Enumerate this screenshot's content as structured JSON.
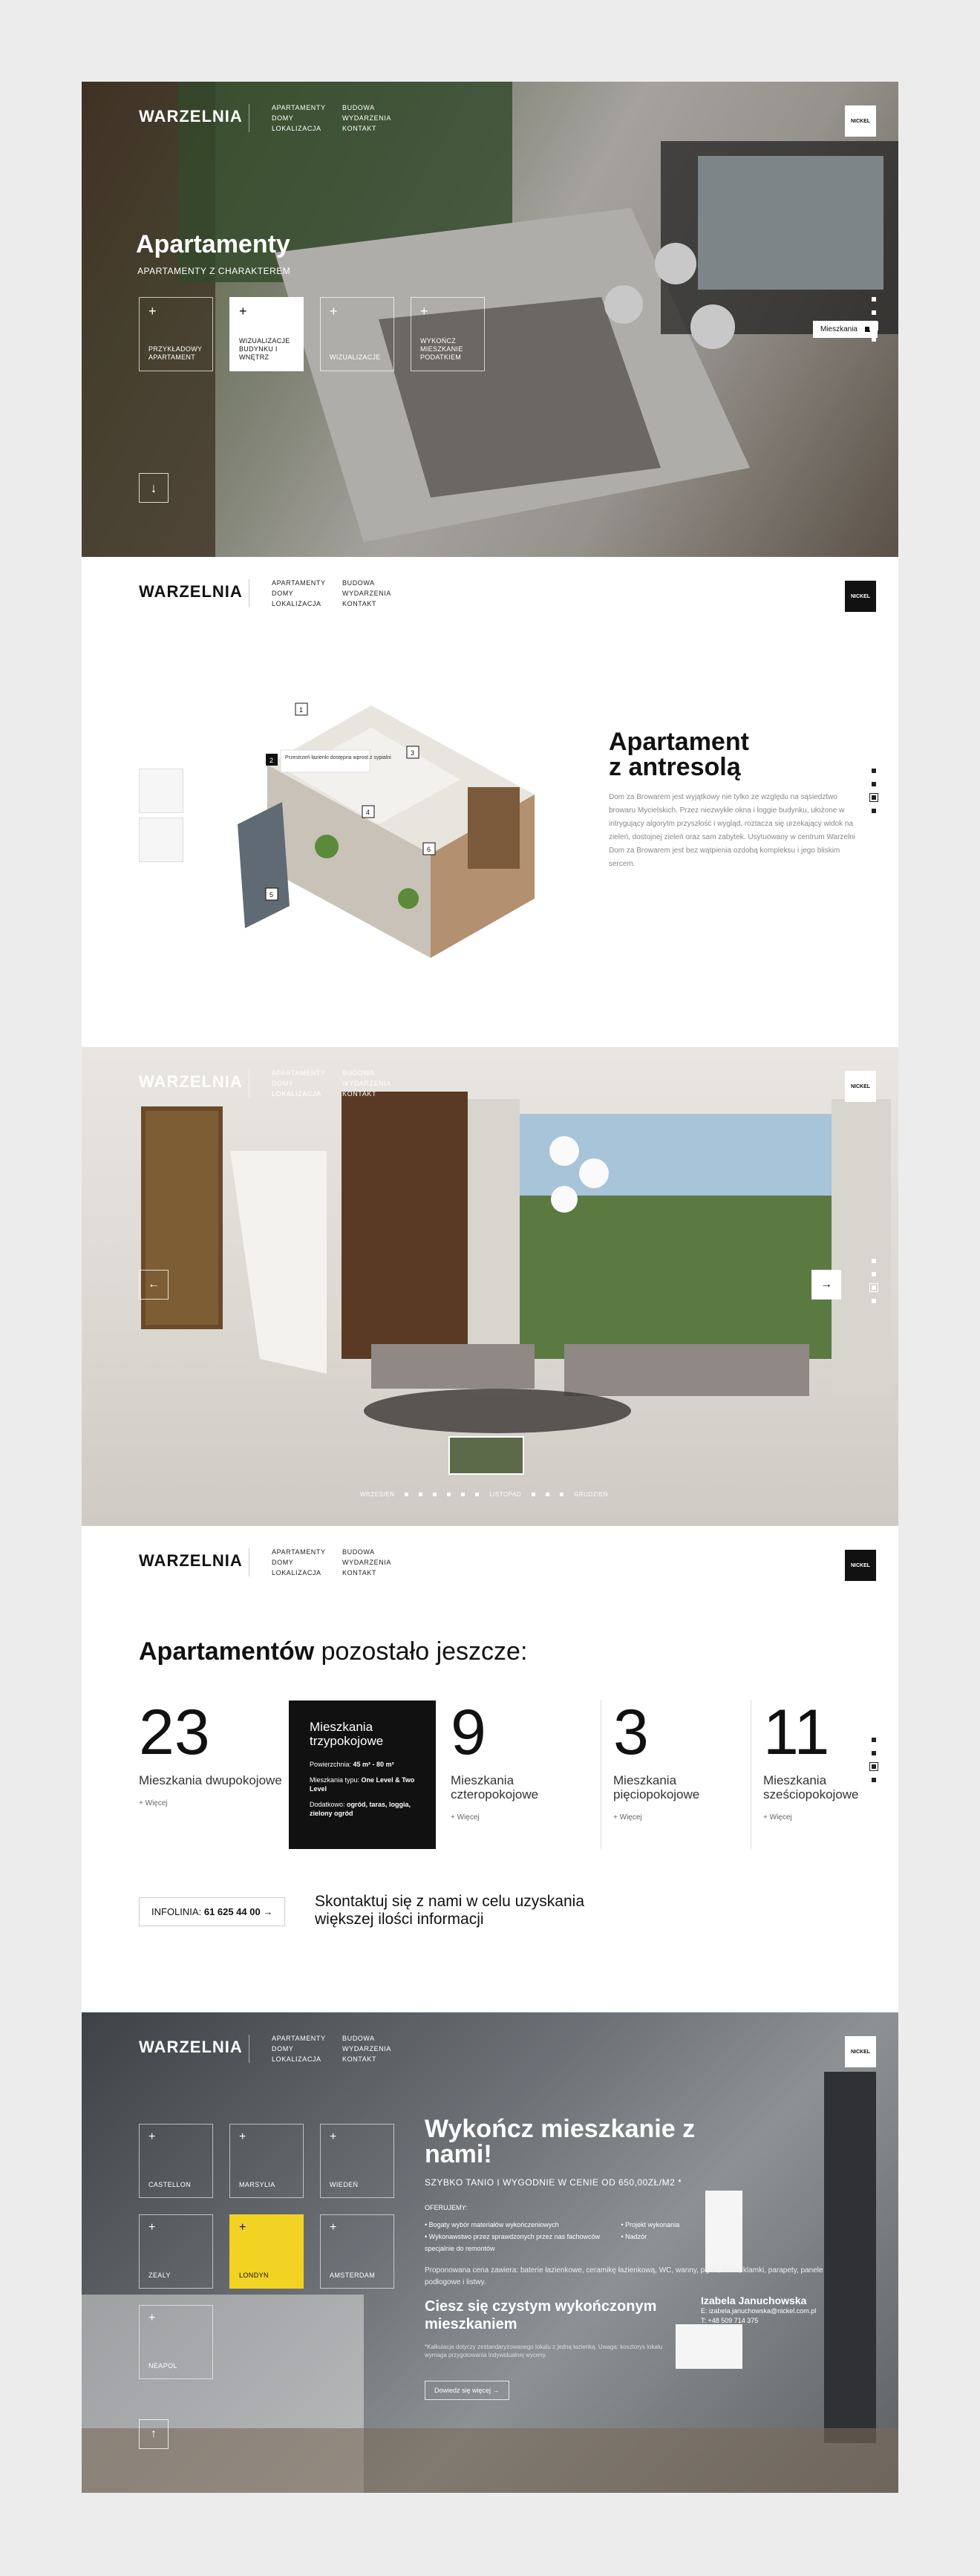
{
  "logo": "WARZELNIA",
  "nav": {
    "items": [
      "APARTAMENTY",
      "BUDOWA",
      "DOMY",
      "WYDARZENIA",
      "LOKALIZACJA",
      "KONTAKT"
    ]
  },
  "brand": "NICKEL",
  "hero": {
    "title": "Apartamenty",
    "subtitle": "APARTAMENTY Z CHARAKTEREM",
    "tiles": [
      {
        "label": "PRZYKŁADOWY APARTAMENT"
      },
      {
        "label": "WIZUALIZACJE BUDYNKU I WNĘTRZ"
      },
      {
        "label": "WIZUALIZACJE"
      },
      {
        "label": "WYKOŃCZ MIESZKANIE PODATKIEM"
      }
    ],
    "tag": "Mieszkania"
  },
  "apartment": {
    "title_line1": "Apartament",
    "title_line2": "z antresolą",
    "description": "Dom za Browarem jest wyjątkowy nie tylko ze względu na sąsiedztwo browaru Mycielskich. Przez niezwykłe okna i loggie budynku, ułożone w intrygujący algorytm przyszłość i wygląd, roztacza się urzekający widok na zieleń, dostojnej zieleń oraz sam zabytek. Usytuowany w centrum Warzelni Dom za Browarem jest bez wątpienia ozdobą kompleksu i jego bliskim sercem.",
    "callouts": [
      "1",
      "2",
      "3",
      "4",
      "5",
      "6"
    ],
    "callout_2_text": "Przestrzeń łazienki dostępna wprost z sypialni"
  },
  "gallery": {
    "timeline": [
      "WRZESIEŃ",
      "LISTOPAD",
      "GRUDZIEŃ"
    ]
  },
  "stats": {
    "heading_bold": "Apartamentów",
    "heading_rest": "pozostało jeszcze:",
    "items": [
      {
        "num": "23",
        "label": "Mieszkania dwupokojowe",
        "more": "Więcej"
      },
      {
        "num": "9",
        "label": "Mieszkania czteropokojowe",
        "more": "Więcej"
      },
      {
        "num": "3",
        "label": "Mieszkania pięciopokojowe",
        "more": "Więcej"
      },
      {
        "num": "11",
        "label": "Mieszkania sześciopokojowe",
        "more": "Więcej"
      }
    ],
    "card": {
      "title": "Mieszkania trzypokojowe",
      "area_label": "Powierzchnia:",
      "area": "45 m² - 80 m²",
      "types_label": "Mieszkania typu:",
      "types": "One Level & Two Level",
      "extras_label": "Dodatkowo:",
      "extras": "ogród, taras, loggia, zielony ogród"
    },
    "infoline_label": "INFOLINIA:",
    "infoline": "61 625 44 00",
    "cta": "Skontaktuj się z nami w celu uzyskania większej ilości informacji"
  },
  "finish": {
    "title": "Wykończ mieszkanie z nami!",
    "subtitle": "SZYBKO TANIO I WYGODNIE W CENIE OD 650,00ZŁ/M2 *",
    "offer": "OFERUJEMY:",
    "list": [
      "Bogaty wybór materiałów wykończeniowych",
      "Wykonawstwo przez sprawdzonych przez nas fachowców specjalnie do remontów",
      "Projekt wykonania",
      "Nadzór"
    ],
    "para": "Proponowana cena zawiera: baterie łazienkowe, ceramikę łazienkową, WC, wanny, płytki, drzwi, klamki, parapety, panele podłogowe i listwy.",
    "clean": "Ciesz się czystym wykończonym mieszkaniem",
    "note": "*Kalkulacja dotyczy zestandaryzowanego lokalu z jedną łazienką. Uwaga: kosztorys lokalu wymaga przygotowania indywidualnej wyceny.",
    "contact_name": "Izabela Januchowska",
    "email": "E: izabela.januchowska@nickel.com.pl",
    "phone": "T: +48 509 714 375",
    "download": "Dowiedz się więcej",
    "tiles": [
      "CASTELLON",
      "MARSYLIA",
      "WIEDEŃ",
      "ZEALY",
      "LONDYN",
      "AMSTERDAM",
      "NEAPOL"
    ]
  }
}
